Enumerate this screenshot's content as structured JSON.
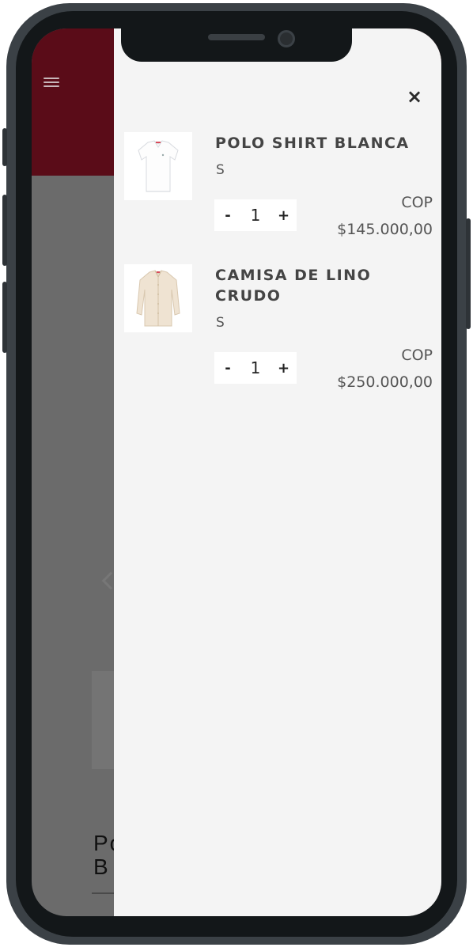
{
  "background_page": {
    "product_title_line1": "Po",
    "product_title_line2": "B"
  },
  "cart": {
    "close_label": "×",
    "items": [
      {
        "name": "POLO SHIRT BLANCA",
        "size": "S",
        "quantity": "1",
        "decrement_label": "-",
        "increment_label": "+",
        "currency": "COP",
        "price": "$145.000,00"
      },
      {
        "name": "CAMISA DE LINO CRUDO",
        "size": "S",
        "quantity": "1",
        "decrement_label": "-",
        "increment_label": "+",
        "currency": "COP",
        "price": "$250.000,00"
      }
    ]
  },
  "colors": {
    "header_bg": "#5a0c18",
    "drawer_bg": "#f4f4f4",
    "overlay": "#6b6b6b"
  }
}
